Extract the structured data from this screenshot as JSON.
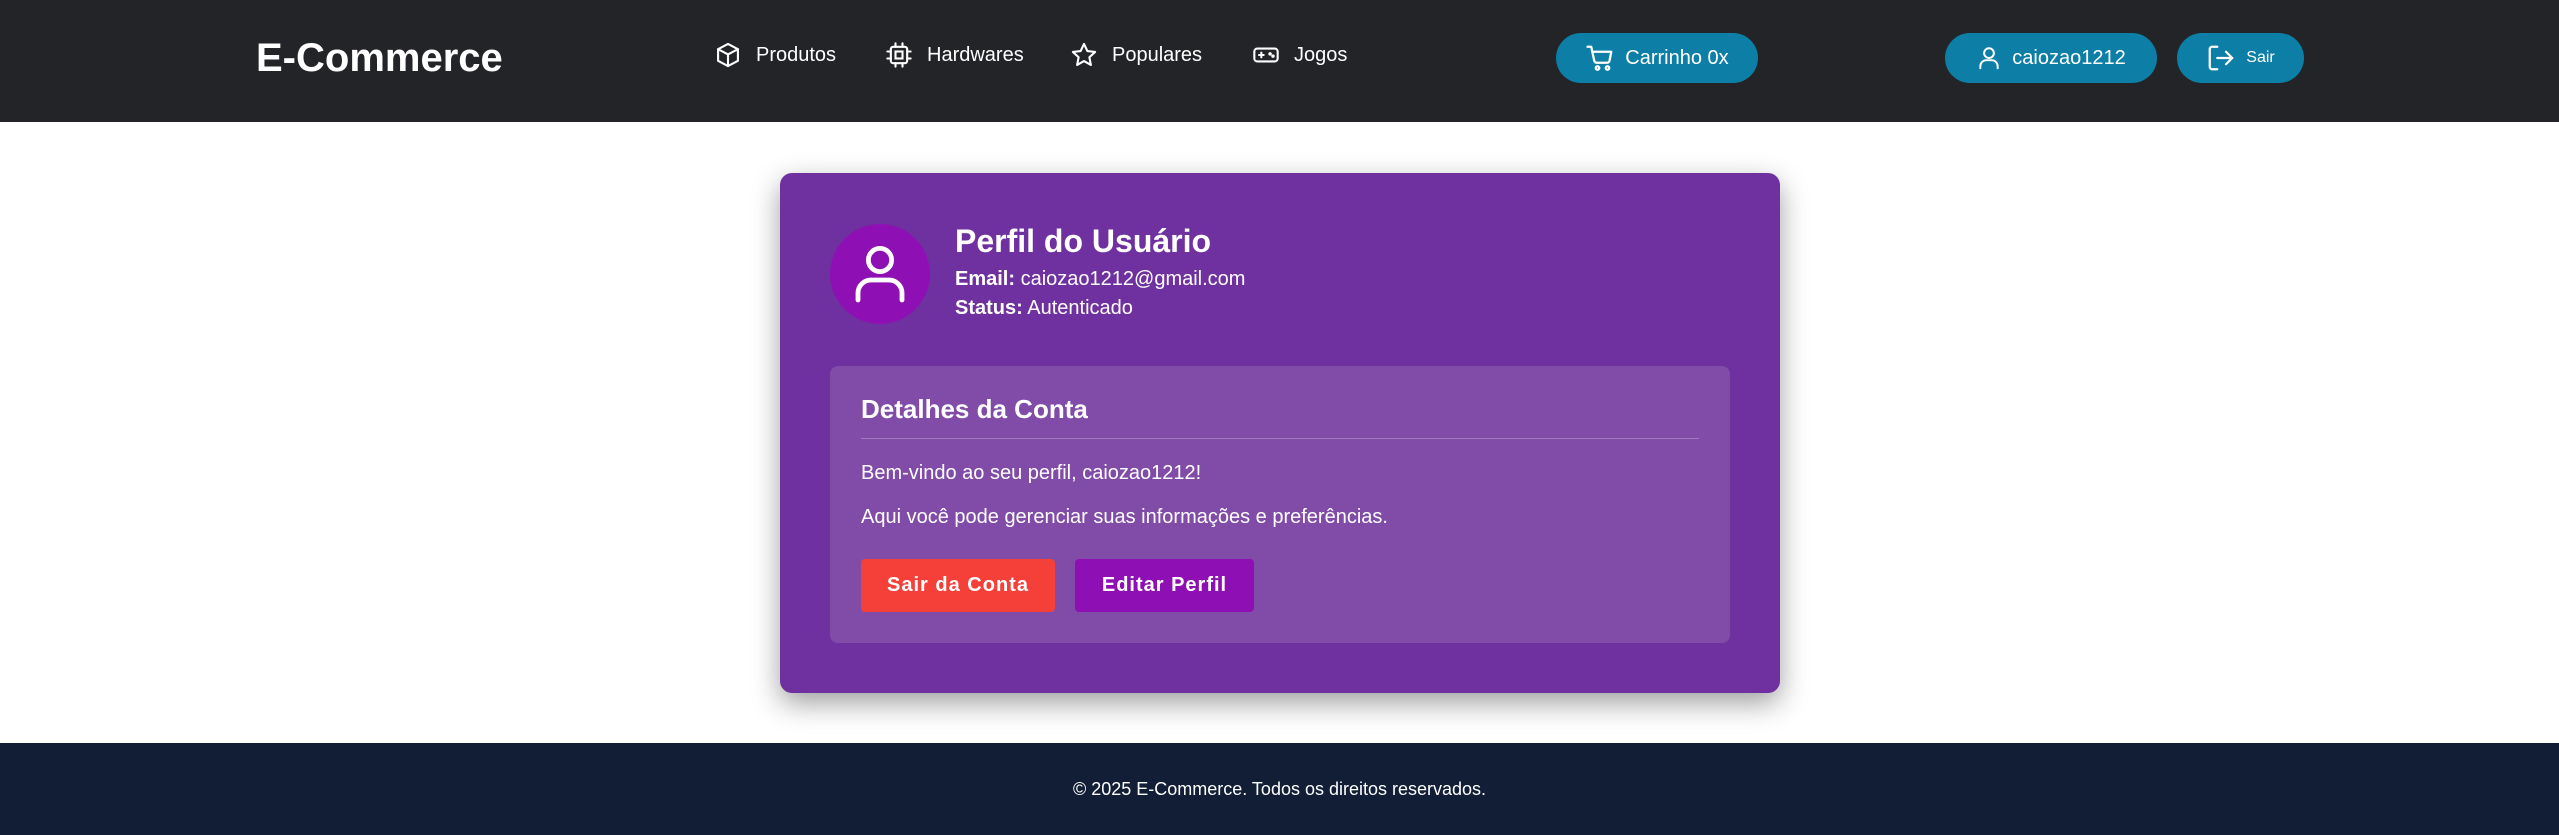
{
  "header": {
    "logo": "E-Commerce",
    "nav": [
      {
        "label": "Produtos",
        "icon": "box-icon"
      },
      {
        "label": "Hardwares",
        "icon": "cpu-icon"
      },
      {
        "label": "Populares",
        "icon": "star-icon"
      },
      {
        "label": "Jogos",
        "icon": "gamepad-icon"
      }
    ],
    "cart_label": "Carrinho 0x",
    "user_label": "caiozao1212",
    "logout_label": "Sair",
    "colors": {
      "background": "#232428",
      "accent": "#0d7fa6"
    }
  },
  "profile": {
    "title": "Perfil do Usuário",
    "email_label": "Email:",
    "email_value": "caiozao1212@gmail.com",
    "status_label": "Status:",
    "status_value": "Autenticado",
    "colors": {
      "card": "#7031a0",
      "avatar": "#8e10b4",
      "panel": "#804ca8"
    }
  },
  "details": {
    "title": "Detalhes da Conta",
    "welcome": "Bem-vindo ao seu perfil, caiozao1212!",
    "description": "Aqui você pode gerenciar suas informações e preferências.",
    "logout_button": "Sair da Conta",
    "edit_button": "Editar Perfil",
    "colors": {
      "logout_button": "#f5403a",
      "edit_button": "#8e10b4"
    }
  },
  "footer": {
    "text": "© 2025 E-Commerce. Todos os direitos reservados.",
    "colors": {
      "background": "#121e36"
    }
  }
}
